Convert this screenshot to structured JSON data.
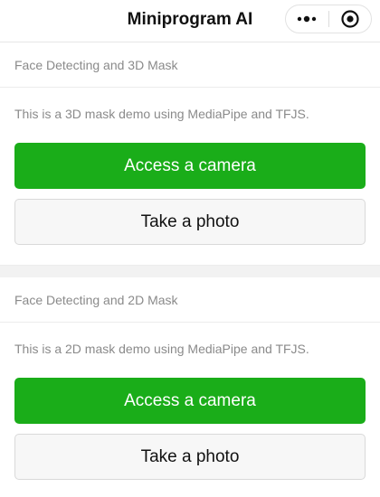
{
  "navbar": {
    "title": "Miniprogram AI",
    "menu_icon": "more-dots-icon",
    "close_icon": "target-circle-icon"
  },
  "sections": [
    {
      "title": "Face Detecting and 3D Mask",
      "description": "This is a 3D mask demo using MediaPipe and TFJS.",
      "primary_button": "Access a camera",
      "secondary_button": "Take a photo"
    },
    {
      "title": "Face Detecting and 2D Mask",
      "description": "This is a 2D mask demo using MediaPipe and TFJS.",
      "primary_button": "Access a camera",
      "secondary_button": "Take a photo"
    }
  ],
  "colors": {
    "primary_green": "#1aad19",
    "secondary_bg": "#f7f7f7",
    "muted_text": "#8a8a8a"
  }
}
